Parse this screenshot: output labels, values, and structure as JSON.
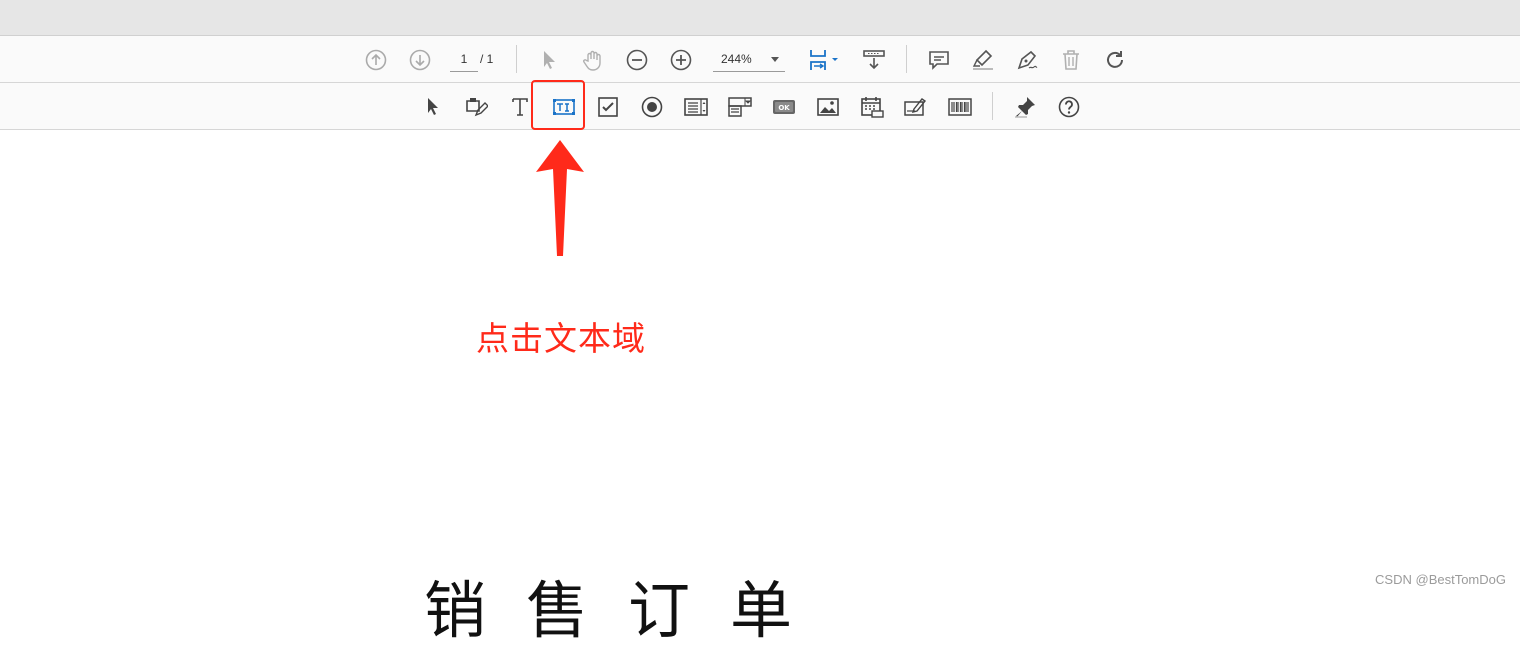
{
  "toolbar": {
    "page_current": "1",
    "page_total": "/ 1",
    "zoom": "244%"
  },
  "annotation": {
    "label": "点击文本域",
    "color": "#ff2a1a"
  },
  "document": {
    "title": "销售订单"
  },
  "watermark": "CSDN @BestTomDoG",
  "icons": {
    "toolbar_row1": [
      "prev-page-icon",
      "next-page-icon",
      "select-arrow-icon",
      "hand-pan-icon",
      "zoom-out-icon",
      "zoom-in-icon",
      "fit-page-icon",
      "download-icon",
      "comment-icon",
      "highlighter-icon",
      "sign-pen-icon",
      "trash-icon",
      "rotate-icon"
    ],
    "toolbar_row2": [
      "select-object-icon",
      "edit-form-icon",
      "add-text-icon",
      "text-field-icon",
      "checkbox-icon",
      "radio-button-icon",
      "list-box-icon",
      "dropdown-icon",
      "button-ok-icon",
      "image-field-icon",
      "date-field-icon",
      "digital-signature-icon",
      "barcode-icon",
      "pin-icon",
      "help-icon"
    ]
  }
}
